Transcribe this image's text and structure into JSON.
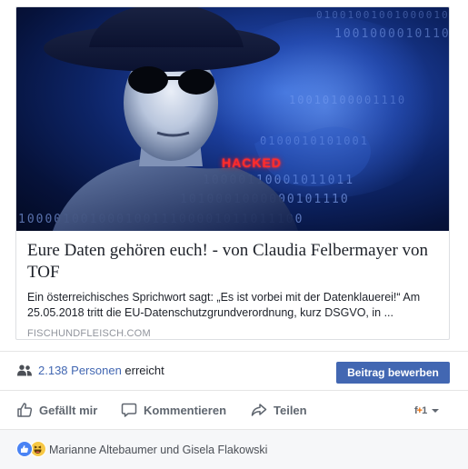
{
  "link_preview": {
    "title": "Eure Daten gehören euch! - von Claudia Felbermayer von TOF",
    "description": "Ein österreichisches Sprichwort sagt: „Es ist vorbei mit der Datenklauerei!“ Am 25.05.2018 tritt die EU-Datenschutzgrundverordnung, kurz DSGVO, in ...",
    "domain": "FISCHUNDFLEISCH.COM",
    "image": {
      "overlay_text": "HACKED",
      "binary_lines": [
        "01001001001000010100",
        "1001000010110100",
        "10010100001110",
        "0100010101001",
        "10000110001011011",
        "1010001000000101110",
        "10000100100010011100001011011100"
      ]
    }
  },
  "reach": {
    "count_text": "2.138 Personen",
    "suffix": "erreicht",
    "boost_label": "Beitrag bewerben"
  },
  "actions": {
    "like_label": "Gefällt mir",
    "comment_label": "Kommentieren",
    "share_label": "Teilen"
  },
  "reactions": {
    "names": "Marianne Altebaumer und Gisela Flakowski",
    "types": [
      "like",
      "haha"
    ]
  },
  "colors": {
    "facebook_blue": "#4267b2",
    "secondary_text": "#606770",
    "hacked_red": "#ff2b2b"
  }
}
